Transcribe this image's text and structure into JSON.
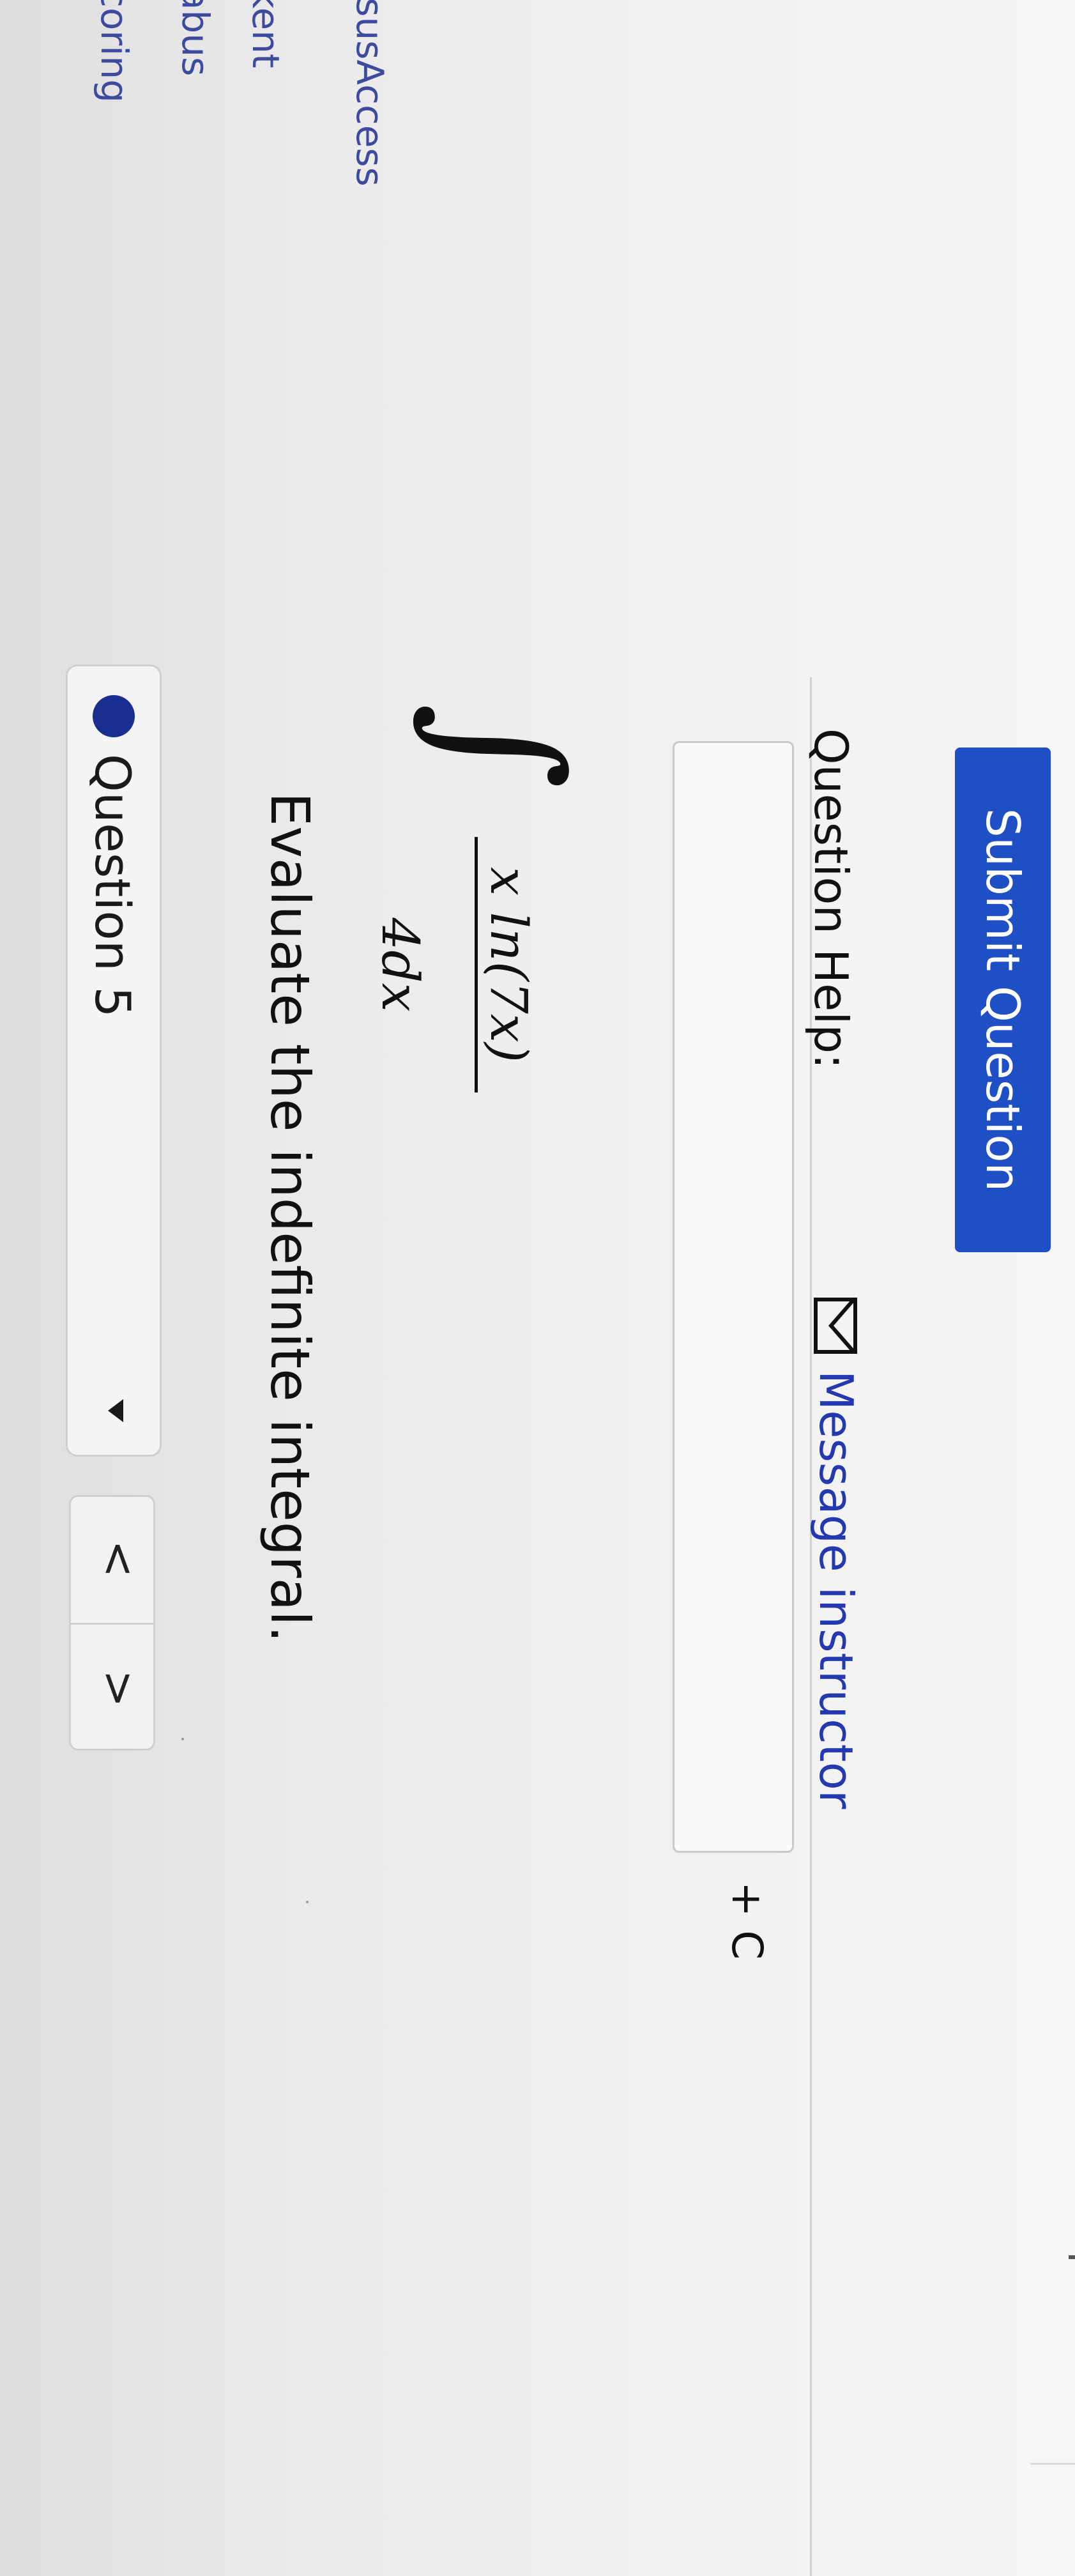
{
  "sidebar": {
    "links": [
      {
        "label": "coring"
      },
      {
        "label": "abus"
      },
      {
        "label": "kent"
      },
      {
        "label": "isusAccess"
      }
    ]
  },
  "question_nav": {
    "selected_label": "Question 5",
    "prev_label": "<",
    "next_label": ">"
  },
  "question": {
    "prompt": "Evaluate the indefinite integral.",
    "integral_sign": "∫",
    "numerator": "4dx",
    "denominator": "x ln(7x)",
    "answer_value": "",
    "constant_label": "+ C"
  },
  "help": {
    "label": "Question Help:",
    "message_link": "Message instructor"
  },
  "submit": {
    "label": "Submit Question"
  },
  "colors": {
    "accent": "#1f4fc4",
    "dot": "#1a2e8f",
    "link": "#2438b0"
  }
}
